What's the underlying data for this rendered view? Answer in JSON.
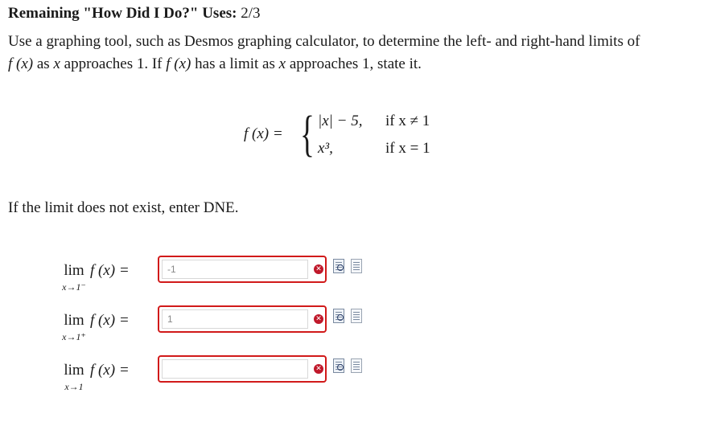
{
  "header": {
    "label": "Remaining \"How Did I Do?\" Uses:",
    "value": "2/3"
  },
  "prompt": {
    "line1": "Use a graphing tool, such as Desmos graphing calculator, to determine the left- and right-hand limits of",
    "line2_a": "f (x)",
    "line2_b": " as ",
    "line2_c": "x",
    "line2_d": " approaches ",
    "line2_e": "1",
    "line2_f": ". If ",
    "line2_g": "f (x)",
    "line2_h": " has a limit as ",
    "line2_i": "x",
    "line2_j": " approaches ",
    "line2_k": "1",
    "line2_l": ", state it."
  },
  "piecewise": {
    "lhs": "f (x) =",
    "row1_expr": "|x| − 5,",
    "row1_cond": "if x ≠ 1",
    "row2_expr": "x³,",
    "row2_cond": "if x = 1"
  },
  "dne_text": "If the limit does not exist, enter DNE.",
  "limits": [
    {
      "lim": "lim",
      "sub": "x→1⁻",
      "fx": "f (x) =",
      "value": "-1"
    },
    {
      "lim": "lim",
      "sub": "x→1⁺",
      "fx": "f (x) =",
      "value": "1"
    },
    {
      "lim": "lim",
      "sub": "x→1",
      "fx": "f (x) =",
      "value": ""
    }
  ],
  "icons": {
    "incorrect": "x-circle-icon",
    "hint": "document-search-icon",
    "solution": "document-icon"
  },
  "colors": {
    "error_border": "#d11a1a",
    "error_icon": "#c0182a"
  }
}
